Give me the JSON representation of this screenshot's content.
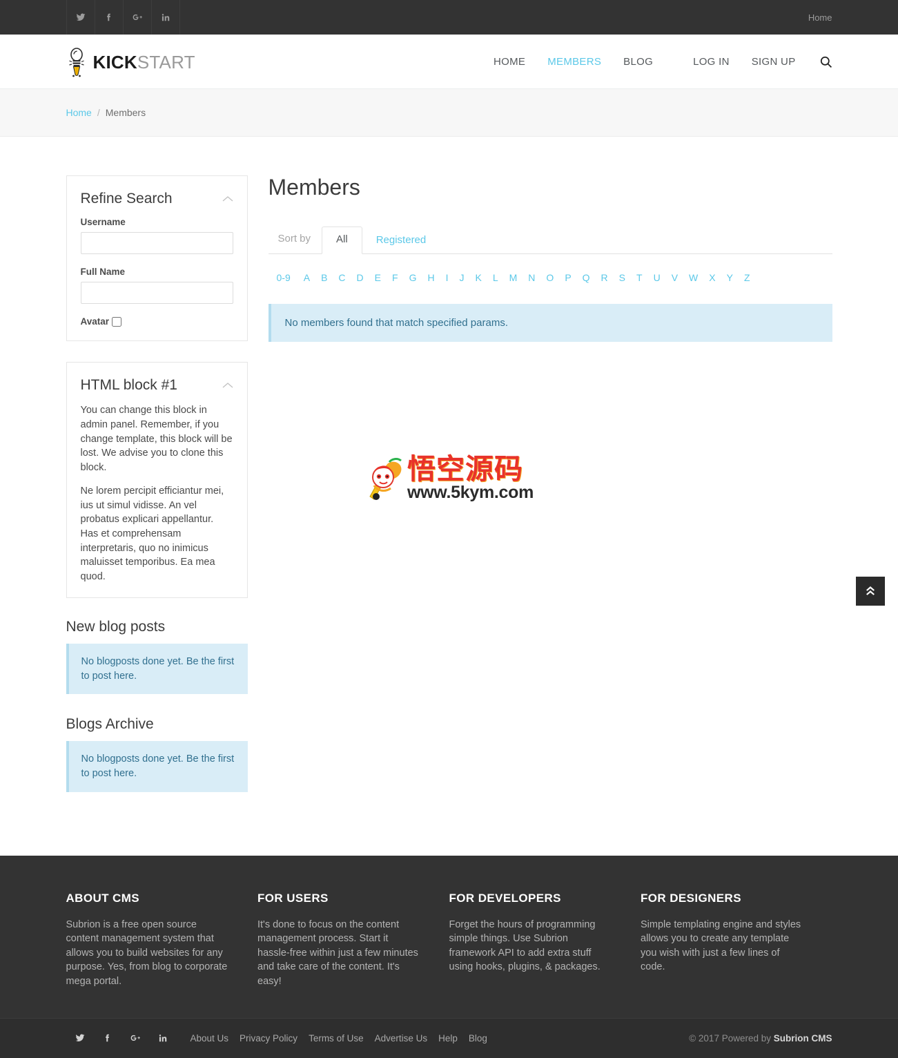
{
  "topbar": {
    "social": [
      {
        "name": "twitter-icon",
        "label": "Twitter"
      },
      {
        "name": "facebook-icon",
        "label": "Facebook"
      },
      {
        "name": "google-plus-icon",
        "label": "Google Plus"
      },
      {
        "name": "linkedin-icon",
        "label": "LinkedIn"
      }
    ],
    "home_link": "Home"
  },
  "header": {
    "logo": {
      "bold": "KICK",
      "light": "START",
      "icon": "lightbulb-rocket-icon"
    },
    "nav": [
      {
        "label": "HOME",
        "active": false
      },
      {
        "label": "MEMBERS",
        "active": true
      },
      {
        "label": "BLOG",
        "active": false
      }
    ],
    "auth": [
      {
        "label": "LOG IN"
      },
      {
        "label": "SIGN UP"
      }
    ],
    "search_icon": "search-icon"
  },
  "breadcrumb": {
    "home": "Home",
    "separator": "/",
    "current": "Members"
  },
  "sidebar": {
    "refine": {
      "title": "Refine Search",
      "username_label": "Username",
      "username_value": "",
      "username_placeholder": "",
      "fullname_label": "Full Name",
      "fullname_value": "",
      "fullname_placeholder": "",
      "avatar_label": "Avatar",
      "avatar_checked": false
    },
    "html_block": {
      "title": "HTML block #1",
      "p1": "You can change this block in admin panel. Remember, if you change template, this block will be lost. We advise you to clone this block.",
      "p2": "Ne lorem percipit efficiantur mei, ius ut simul vidisse. An vel probatus explicari appellantur. Has et comprehensam interpretaris, quo no inimicus maluisset temporibus. Ea mea quod."
    },
    "new_blog_posts": {
      "title": "New blog posts",
      "message": "No blogposts done yet. Be the first to post here."
    },
    "blogs_archive": {
      "title": "Blogs Archive",
      "message": "No blogposts done yet. Be the first to post here."
    }
  },
  "main": {
    "title": "Members",
    "sort_by_label": "Sort by",
    "tabs": [
      {
        "label": "All",
        "active": true
      },
      {
        "label": "Registered",
        "active": false
      }
    ],
    "alphabet": [
      "0-9",
      "A",
      "B",
      "C",
      "D",
      "E",
      "F",
      "G",
      "H",
      "I",
      "J",
      "K",
      "L",
      "M",
      "N",
      "O",
      "P",
      "Q",
      "R",
      "S",
      "T",
      "U",
      "V",
      "W",
      "X",
      "Y",
      "Z"
    ],
    "empty_message": "No members found that match specified params."
  },
  "watermark": {
    "chinese": "悟空源码",
    "url": "www.5kym.com"
  },
  "scroll_top": {
    "icon": "double-chevron-up-icon"
  },
  "footer": {
    "columns": [
      {
        "title": "ABOUT CMS",
        "text": "Subrion is a free open source content management system that allows you to build websites for any purpose. Yes, from blog to corporate mega portal."
      },
      {
        "title": "FOR USERS",
        "text": "It's done to focus on the content management process. Start it hassle-free within just a few minutes and take care of the content. It's easy!"
      },
      {
        "title": "FOR DEVELOPERS",
        "text": "Forget the hours of programming simple things. Use Subrion framework API to add extra stuff using hooks, plugins, & packages."
      },
      {
        "title": "FOR DESIGNERS",
        "text": "Simple templating engine and styles allows you to create any template you wish with just a few lines of code."
      }
    ],
    "social": [
      {
        "name": "twitter-icon",
        "label": "Twitter"
      },
      {
        "name": "facebook-icon",
        "label": "Facebook"
      },
      {
        "name": "google-plus-icon",
        "label": "Google Plus"
      },
      {
        "name": "linkedin-icon",
        "label": "LinkedIn"
      }
    ],
    "links": [
      "About Us",
      "Privacy Policy",
      "Terms of Use",
      "Advertise Us",
      "Help",
      "Blog"
    ],
    "copyright_prefix": "© 2017 Powered by ",
    "copyright_brand": "Subrion CMS"
  },
  "colors": {
    "accent": "#5bc8e8",
    "dark": "#333333",
    "info_bg": "#d9edf7",
    "info_text": "#31708f"
  }
}
